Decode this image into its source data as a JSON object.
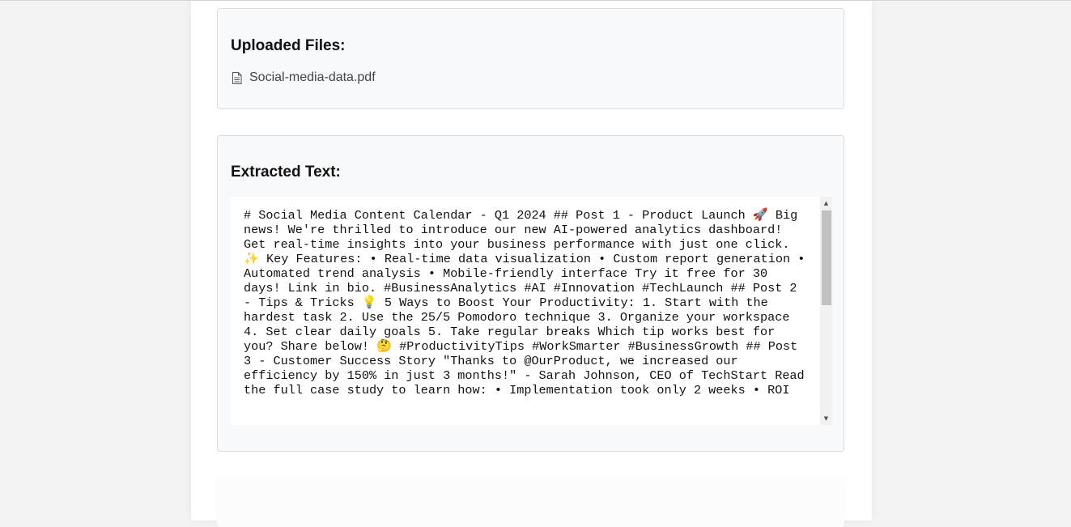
{
  "uploaded_files": {
    "title": "Uploaded Files:",
    "files": [
      {
        "name": "Social-media-data.pdf",
        "icon": "document-icon"
      }
    ]
  },
  "extracted_text": {
    "title": "Extracted Text:",
    "content": "# Social Media Content Calendar - Q1 2024  ## Post 1 - Product Launch 🚀  Big news! We're thrilled to introduce our new AI-powered analytics dashboard!  Get real-time insights into your business performance with just one click.  ✨  Key Features:  • Real-time data visualization  • Custom report generation  • Automated trend analysis  • Mobile-friendly interface  Try it free for 30 days! Link in bio.  #BusinessAnalytics #AI #Innovation #TechLaunch  ## Post 2 - Tips & Tricks  💡  5 Ways to Boost Your Productivity:  1. Start with the hardest task  2. Use the 25/5 Pomodoro technique  3. Organize your workspace  4. Set clear daily goals  5. Take regular breaks  Which tip works best for you? Share below!  🤔 #ProductivityTips #WorkSmarter #BusinessGrowth  ## Post 3 - Customer Success Story  \"Thanks to @OurProduct, we increased our efficiency by 150% in just 3 months!\"  - Sarah Johnson, CEO of TechStart  Read the full case study to learn how:  • Implementation took only 2 weeks  • ROI"
  }
}
